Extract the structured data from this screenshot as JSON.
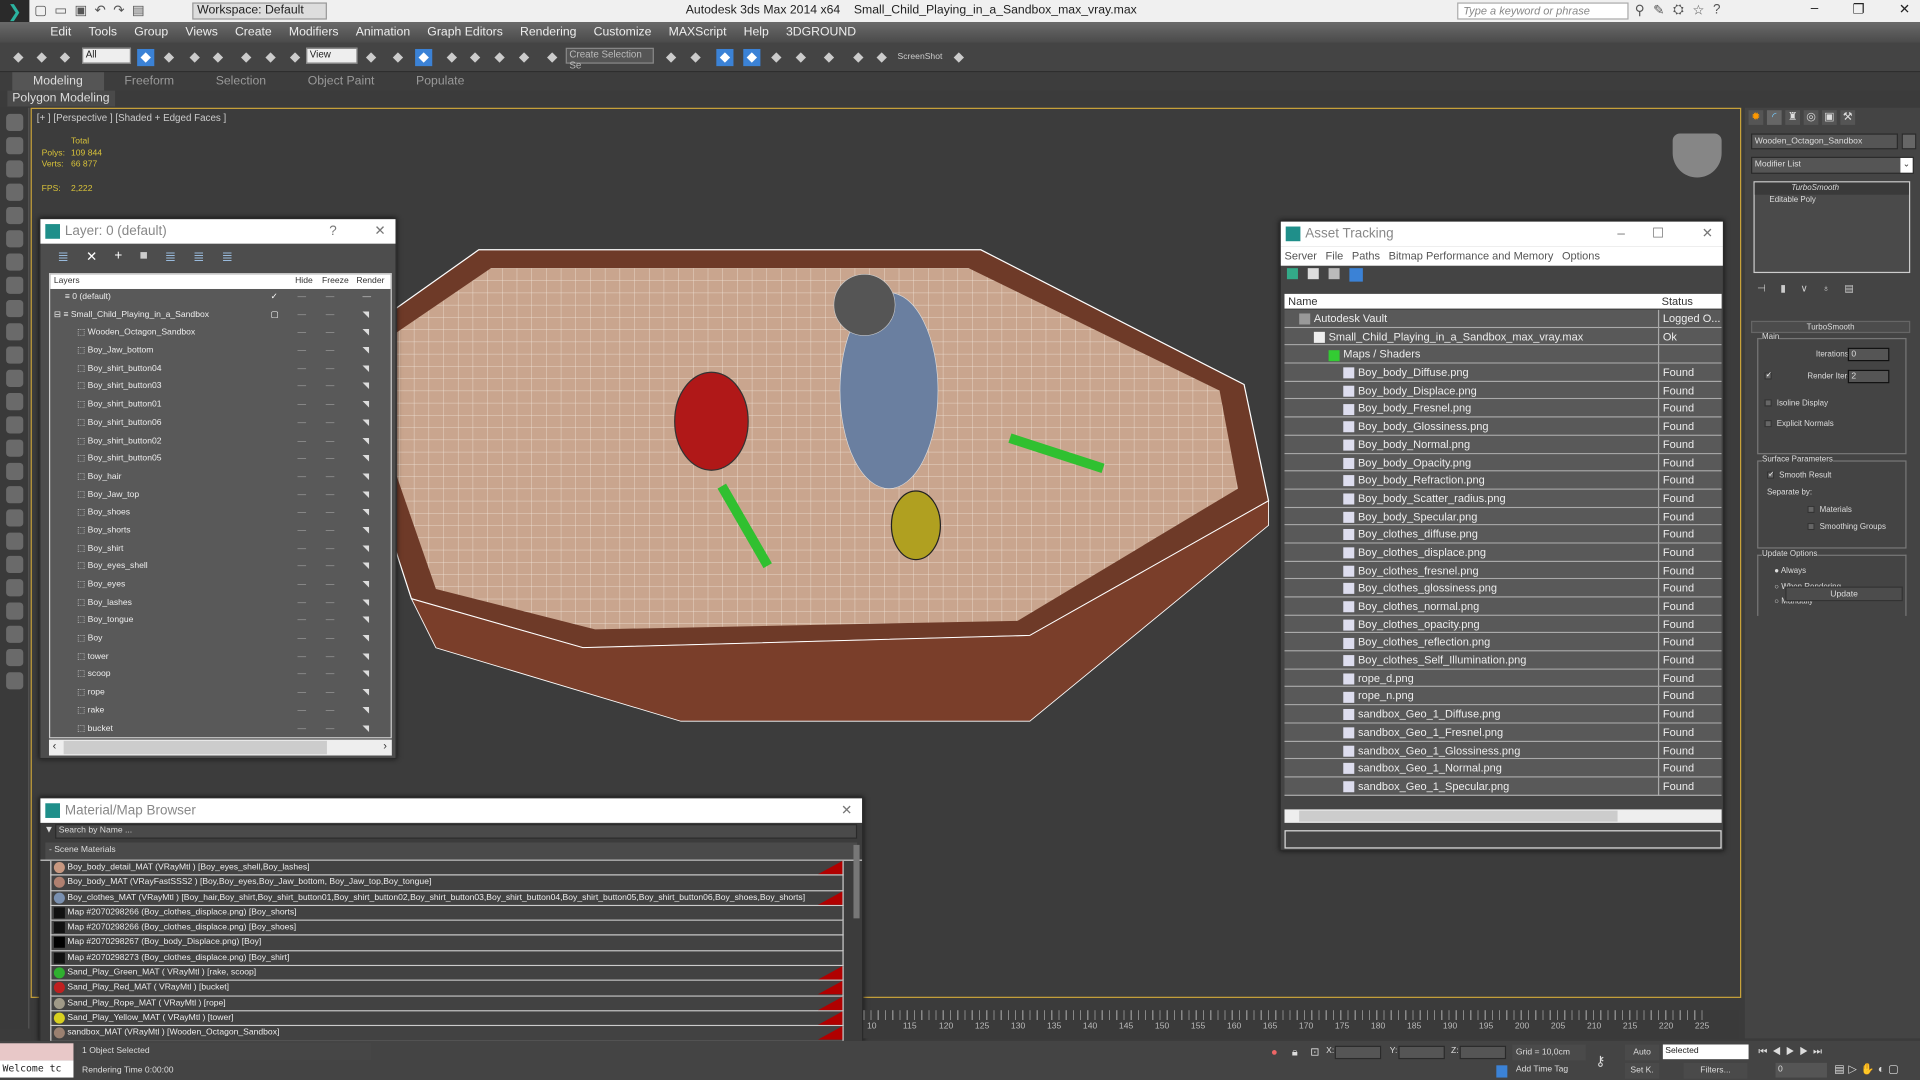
{
  "titlebar": {
    "workspace": "Workspace: Default",
    "app_title": "Autodesk 3ds Max  2014 x64",
    "file": "Small_Child_Playing_in_a_Sandbox_max_vray.max",
    "search_placeholder": "Type a keyword or phrase"
  },
  "menu": [
    "Edit",
    "Tools",
    "Group",
    "Views",
    "Create",
    "Modifiers",
    "Animation",
    "Graph Editors",
    "Rendering",
    "Customize",
    "MAXScript",
    "Help",
    "3DGROUND"
  ],
  "toolbar": {
    "filter": "All",
    "ref_coord": "View",
    "named_sel": "Create Selection Se",
    "screenshot": "ScreenShot"
  },
  "ribbon": {
    "tabs": [
      "Modeling",
      "Freeform",
      "Selection",
      "Object Paint",
      "Populate"
    ],
    "active": "Modeling",
    "panel": "Polygon Modeling"
  },
  "viewport": {
    "label": "[+ ] [Perspective ] [Shaded + Edged Faces ]",
    "stats": {
      "total": "Total",
      "polys_label": "Polys:",
      "polys": "109 844",
      "verts_label": "Verts:",
      "verts": "66 877",
      "fps_label": "FPS:",
      "fps": "2,222"
    }
  },
  "layers": {
    "title": "Layer: 0 (default)",
    "cols": {
      "name": "Layers",
      "hide": "Hide",
      "freeze": "Freeze",
      "render": "Render"
    },
    "items": [
      "0 (default)",
      "Small_Child_Playing_in_a_Sandbox",
      "Wooden_Octagon_Sandbox",
      "Boy_Jaw_bottom",
      "Boy_shirt_button04",
      "Boy_shirt_button03",
      "Boy_shirt_button01",
      "Boy_shirt_button06",
      "Boy_shirt_button02",
      "Boy_shirt_button05",
      "Boy_hair",
      "Boy_Jaw_top",
      "Boy_shoes",
      "Boy_shorts",
      "Boy_shirt",
      "Boy_eyes_shell",
      "Boy_eyes",
      "Boy_lashes",
      "Boy_tongue",
      "Boy",
      "tower",
      "scoop",
      "rope",
      "rake",
      "bucket"
    ]
  },
  "material_browser": {
    "title": "Material/Map Browser",
    "search_placeholder": "Search by Name ...",
    "group": "- Scene Materials",
    "items": [
      {
        "text": "Boy_body_detail_MAT (VRayMtl ) [Boy_eyes_shell,Boy_lashes]",
        "color": "#c89880",
        "flag": true
      },
      {
        "text": "Boy_body_MAT (VRayFastSSS2 ) [Boy,Boy_eyes,Boy_Jaw_bottom, Boy_Jaw_top,Boy_tongue]",
        "color": "#b08070",
        "flag": false
      },
      {
        "text": "Boy_clothes_MAT (VRayMtl ) [Boy_hair,Boy_shirt,Boy_shirt_button01,Boy_shirt_button02,Boy_shirt_button03,Boy_shirt_button04,Boy_shirt_button05,Boy_shirt_button06,Boy_shoes,Boy_shorts]",
        "color": "#7a90b0",
        "flag": true
      },
      {
        "text": "Map #2070298266 (Boy_clothes_displace.png) [Boy_shorts]",
        "color": "#111",
        "flag": false
      },
      {
        "text": "Map #2070298266 (Boy_clothes_displace.png) [Boy_shoes]",
        "color": "#111",
        "flag": false
      },
      {
        "text": "Map #2070298267 (Boy_body_Displace.png) [Boy]",
        "color": "#000",
        "flag": false
      },
      {
        "text": "Map #2070298273 (Boy_clothes_displace.png) [Boy_shirt]",
        "color": "#111",
        "flag": false
      },
      {
        "text": "Sand_Play_Green_MAT ( VRayMtl ) [rake, scoop]",
        "color": "#30b030",
        "flag": true
      },
      {
        "text": "Sand_Play_Red_MAT ( VRayMtl ) [bucket]",
        "color": "#c02020",
        "flag": true
      },
      {
        "text": "Sand_Play_Rope_MAT ( VRayMtl ) [rope]",
        "color": "#a09a88",
        "flag": true
      },
      {
        "text": "Sand_Play_Yellow_MAT ( VRayMtl ) [tower]",
        "color": "#d8d020",
        "flag": true
      },
      {
        "text": "sandbox_MAT (VRayMtl ) [Wooden_Octagon_Sandbox]",
        "color": "#9a8070",
        "flag": true
      }
    ]
  },
  "asset_tracking": {
    "title": "Asset Tracking",
    "menu": [
      "Server",
      "File",
      "Paths",
      "Bitmap Performance and Memory",
      "Options"
    ],
    "cols": {
      "name": "Name",
      "status": "Status"
    },
    "rows": [
      {
        "name": "Autodesk Vault",
        "status": "Logged O...",
        "level": 0
      },
      {
        "name": "Small_Child_Playing_in_a_Sandbox_max_vray.max",
        "status": "Ok",
        "level": 1
      },
      {
        "name": "Maps / Shaders",
        "status": "",
        "level": 2
      },
      {
        "name": "Boy_body_Diffuse.png",
        "status": "Found",
        "level": 3
      },
      {
        "name": "Boy_body_Displace.png",
        "status": "Found",
        "level": 3
      },
      {
        "name": "Boy_body_Fresnel.png",
        "status": "Found",
        "level": 3
      },
      {
        "name": "Boy_body_Glossiness.png",
        "status": "Found",
        "level": 3
      },
      {
        "name": "Boy_body_Normal.png",
        "status": "Found",
        "level": 3
      },
      {
        "name": "Boy_body_Opacity.png",
        "status": "Found",
        "level": 3
      },
      {
        "name": "Boy_body_Refraction.png",
        "status": "Found",
        "level": 3
      },
      {
        "name": "Boy_body_Scatter_radius.png",
        "status": "Found",
        "level": 3
      },
      {
        "name": "Boy_body_Specular.png",
        "status": "Found",
        "level": 3
      },
      {
        "name": "Boy_clothes_diffuse.png",
        "status": "Found",
        "level": 3
      },
      {
        "name": "Boy_clothes_displace.png",
        "status": "Found",
        "level": 3
      },
      {
        "name": "Boy_clothes_fresnel.png",
        "status": "Found",
        "level": 3
      },
      {
        "name": "Boy_clothes_glossiness.png",
        "status": "Found",
        "level": 3
      },
      {
        "name": "Boy_clothes_normal.png",
        "status": "Found",
        "level": 3
      },
      {
        "name": "Boy_clothes_opacity.png",
        "status": "Found",
        "level": 3
      },
      {
        "name": "Boy_clothes_reflection.png",
        "status": "Found",
        "level": 3
      },
      {
        "name": "Boy_clothes_Self_Illumination.png",
        "status": "Found",
        "level": 3
      },
      {
        "name": "rope_d.png",
        "status": "Found",
        "level": 3
      },
      {
        "name": "rope_n.png",
        "status": "Found",
        "level": 3
      },
      {
        "name": "sandbox_Geo_1_Diffuse.png",
        "status": "Found",
        "level": 3
      },
      {
        "name": "sandbox_Geo_1_Fresnel.png",
        "status": "Found",
        "level": 3
      },
      {
        "name": "sandbox_Geo_1_Glossiness.png",
        "status": "Found",
        "level": 3
      },
      {
        "name": "sandbox_Geo_1_Normal.png",
        "status": "Found",
        "level": 3
      },
      {
        "name": "sandbox_Geo_1_Specular.png",
        "status": "Found",
        "level": 3
      }
    ]
  },
  "command_panel": {
    "object_name": "Wooden_Octagon_Sandbox",
    "modifier_list": "Modifier List",
    "stack": [
      "TurboSmooth",
      "Editable Poly"
    ],
    "rollout": "TurboSmooth",
    "main": "Main",
    "iterations_label": "Iterations:",
    "iterations": "0",
    "render_iters_label": "Render Iters:",
    "render_iters": "2",
    "render_iters_checked": true,
    "isoline": "Isoline Display",
    "isoline_checked": false,
    "explicit": "Explicit Normals",
    "explicit_checked": false,
    "surface": "Surface Parameters",
    "smooth_result": "Smooth Result",
    "smooth_checked": true,
    "separate": "Separate by:",
    "materials": "Materials",
    "smoothing_groups": "Smoothing Groups",
    "update_options": "Update Options",
    "radio": [
      "Always",
      "When Rendering",
      "Manually"
    ],
    "radio_selected": "Always",
    "update": "Update"
  },
  "timeline": {
    "ticks": [
      "10",
      "115",
      "120",
      "125",
      "130",
      "135",
      "140",
      "145",
      "150",
      "155",
      "160",
      "165",
      "170",
      "175",
      "180",
      "185",
      "190",
      "195",
      "200",
      "205",
      "210",
      "215",
      "220",
      "225"
    ]
  },
  "status": {
    "welcome": "Welcome tc",
    "selected": "1 Object Selected",
    "render_time": "Rendering Time  0:00:00",
    "x": "X:",
    "y": "Y:",
    "z": "Z:",
    "grid": "Grid = 10,0cm",
    "add_time_tag": "Add Time Tag",
    "auto": "Auto",
    "setk": "Set K.",
    "key_filter": "Selected",
    "filters": "Filters...",
    "frame": "0"
  }
}
